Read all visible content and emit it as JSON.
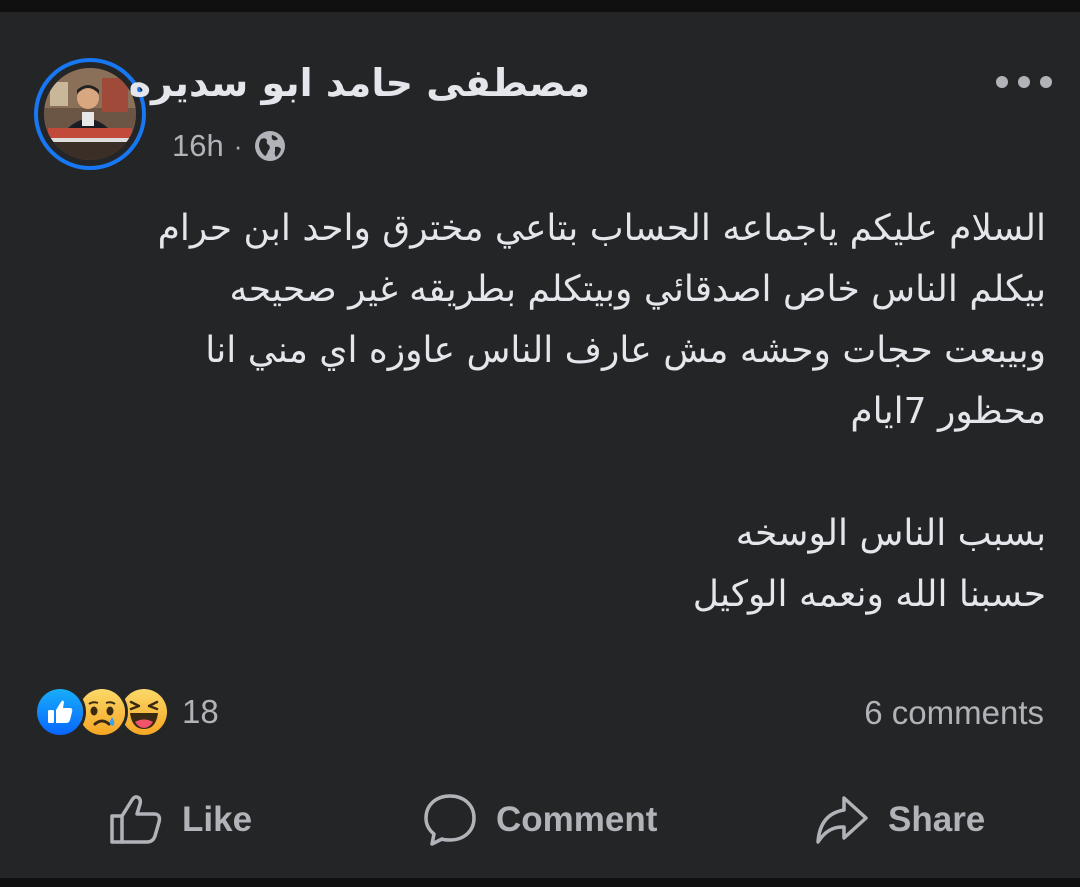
{
  "post": {
    "author": "مصطفى حامد ابو سديره",
    "time": "16h",
    "separator": "·",
    "audience_icon": "globe-icon",
    "more_icon": "more-options-icon",
    "text_lines": [
      "السلام عليكم ياجماعه الحساب بتاعي مخترق واحد ابن حرام",
      "بيكلم الناس خاص اصدقائي وبيتكلم بطريقه غير صحيحه",
      "وبيبعت حجات وحشه مش عارف الناس عاوزه اي مني انا",
      "محظور 7ايام",
      "",
      "بسبب الناس الوسخه",
      "حسبنا الله ونعمه الوكيل"
    ]
  },
  "reactions": {
    "icons": [
      "like-reaction-icon",
      "sad-reaction-icon",
      "haha-reaction-icon"
    ],
    "count": "18",
    "comments": "6 comments"
  },
  "actions": {
    "like": "Like",
    "comment": "Comment",
    "share": "Share"
  },
  "colors": {
    "card_bg": "#242526",
    "text_primary": "#e4e6eb",
    "text_secondary": "#b0b3b8",
    "accent": "#1877f2"
  }
}
